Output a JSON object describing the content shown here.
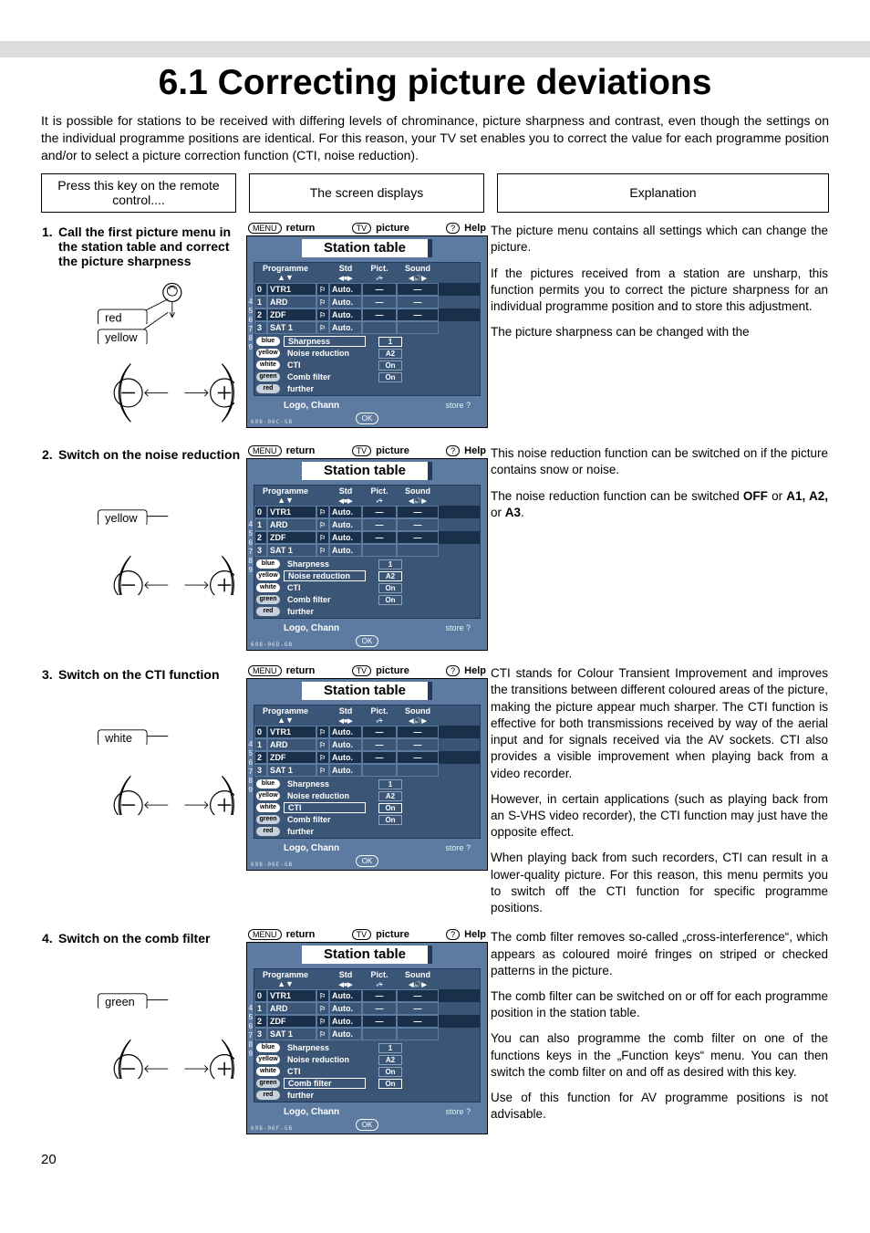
{
  "page_number": "20",
  "title": "6.1 Correcting picture deviations",
  "intro": "It is possible for stations to be received with differing levels of chrominance, picture sharpness and contrast, even though the settings on the individual programme positions are identical. For this reason, your TV set enables you to correct the value for each programme position and/or to select a picture correction function (CTI, noise reduction).",
  "col_heads": {
    "left": "Press this key on the remote control....",
    "mid": "The screen displays",
    "right": "Explanation"
  },
  "osd_common": {
    "bar": {
      "return": "return",
      "menu": "MENU",
      "tv": "TV",
      "picture": "picture",
      "q": "?",
      "help": "Help"
    },
    "title": "Station table",
    "head": {
      "prog": "Programme",
      "std": "Std",
      "pict": "Pict.",
      "sound": "Sound"
    },
    "rows": [
      {
        "n": "0",
        "name": "VTR1",
        "std": "Auto.",
        "p": "—",
        "s": "—"
      },
      {
        "n": "1",
        "name": "ARD",
        "std": "Auto.",
        "p": "—",
        "s": "—"
      },
      {
        "n": "2",
        "name": "ZDF",
        "std": "Auto.",
        "p": "—",
        "s": "—"
      },
      {
        "n": "3",
        "name": "SAT 1",
        "std": "Auto.",
        "p": "",
        "s": ""
      }
    ],
    "extra_nums": [
      "4",
      "5",
      "6",
      "7",
      "8",
      "9"
    ],
    "settings": [
      {
        "chip": "blue",
        "label": "Sharpness",
        "val": "1"
      },
      {
        "chip": "yellow",
        "label": "Noise reduction",
        "val": "A2"
      },
      {
        "chip": "white",
        "label": "CTI",
        "val": "On"
      },
      {
        "chip": "green",
        "label": "Comb filter",
        "val": "On"
      },
      {
        "chip": "red",
        "label": "further",
        "val": ""
      }
    ],
    "logo": "Logo, Chann",
    "store": "store ?",
    "ok": "OK"
  },
  "codes": [
    "698-06C-GB",
    "698-06D-GB",
    "698-06E-GB",
    "698-06F-GB"
  ],
  "steps": [
    {
      "num": "1.",
      "title": "Call the first picture menu in the station table and correct the picture sharpness",
      "colors": [
        "red",
        "yellow"
      ],
      "highlight": 0,
      "explain": [
        "The picture menu contains all settings which can change the picture.",
        "If the pictures received from a station are unsharp, this function permits you to correct the picture sharpness for an individual programme position and to store this adjustment.",
        "The picture sharpness can be changed with the"
      ]
    },
    {
      "num": "2.",
      "title": "Switch on the noise reduction",
      "colors": [
        "yellow"
      ],
      "highlight": 1,
      "explain": [
        "This noise reduction function can be switched on if the picture contains snow or noise.",
        "The noise reduction function can be switched <b>OFF</b> or <b>A1, A2,</b> or <b>A3</b>."
      ]
    },
    {
      "num": "3.",
      "title": "Switch on the CTI function",
      "colors": [
        "white"
      ],
      "highlight": 2,
      "explain": [
        "CTI stands for Colour Transient Improvement and improves the transitions between different coloured areas of the picture, making the picture appear much sharper. The CTI function is effective for both transmissions received by way of the aerial input and for signals received via the AV sockets. CTI also provides a visible improvement when playing back from a video recorder.",
        "However, in certain applications (such as playing back from an S-VHS video recorder), the CTI function may just have the opposite effect.",
        "When playing back from such recorders, CTI can result in a lower-quality picture. For this reason, this menu permits you to switch off the CTI function for specific programme positions."
      ]
    },
    {
      "num": "4.",
      "title": "Switch on the comb filter",
      "colors": [
        "green"
      ],
      "highlight": 3,
      "explain": [
        "The comb filter removes so-called „cross-interference“, which appears as coloured moiré fringes on striped or checked patterns in the picture.",
        "The comb filter can be switched on or off for each programme position in the station table.",
        "You can also programme the comb filter on one of the functions keys in the „Function keys“ menu. You can then switch the comb filter on and off as desired with this key.",
        "Use of this function for AV programme positions is not advisable."
      ]
    }
  ]
}
